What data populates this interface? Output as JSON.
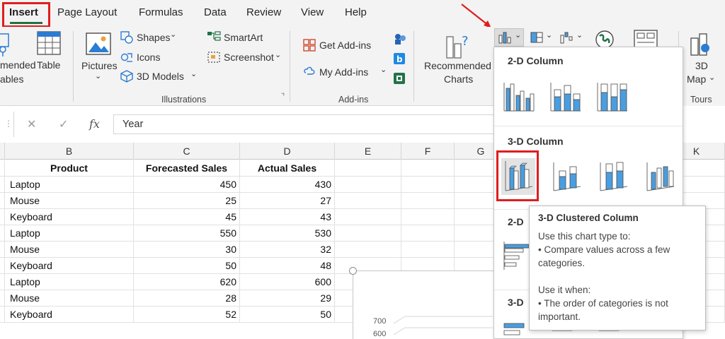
{
  "tabs": {
    "items": [
      "Insert",
      "Page Layout",
      "Formulas",
      "Data",
      "Review",
      "View",
      "Help"
    ]
  },
  "ribbon": {
    "tables": {
      "recommended_pivot_label_1": "mended",
      "recommended_pivot_label_2": "ables",
      "table_label": "Table"
    },
    "illustrations": {
      "pictures_label": "Pictures",
      "shapes_label": "Shapes",
      "icons_label": "Icons",
      "models_label": "3D Models",
      "smartart_label": "SmartArt",
      "screenshot_label": "Screenshot",
      "group_label": "Illustrations"
    },
    "addins": {
      "get_label": "Get Add-ins",
      "my_label": "My Add-ins",
      "group_label": "Add-ins"
    },
    "charts": {
      "recommended_line1": "Recommended",
      "recommended_line2": "Charts"
    },
    "tours": {
      "map_line1": "3D",
      "map_line2": "Map",
      "group_label": "Tours"
    }
  },
  "formula_bar": {
    "fx_label": "fx",
    "value": "Year"
  },
  "grid": {
    "column_headers": [
      "B",
      "C",
      "D",
      "E",
      "F",
      "G",
      "K"
    ],
    "table_headers": [
      "Product",
      "Forecasted Sales",
      "Actual Sales"
    ],
    "rows": [
      [
        "Laptop",
        "450",
        "430"
      ],
      [
        "Mouse",
        "25",
        "27"
      ],
      [
        "Keyboard",
        "45",
        "43"
      ],
      [
        "Laptop",
        "550",
        "530"
      ],
      [
        "Mouse",
        "30",
        "32"
      ],
      [
        "Keyboard",
        "50",
        "48"
      ],
      [
        "Laptop",
        "620",
        "600"
      ],
      [
        "Mouse",
        "28",
        "29"
      ],
      [
        "Keyboard",
        "52",
        "50"
      ]
    ]
  },
  "chart_preview": {
    "axis_labels": [
      "700",
      "600"
    ]
  },
  "gallery": {
    "section_2d_column": "2-D Column",
    "section_3d_column": "3-D Column",
    "section_2d_bar_partial": "2-D",
    "section_3d_bar_partial": "3-D"
  },
  "tooltip": {
    "title": "3-D Clustered Column",
    "line1": "Use this chart type to:",
    "line2": "• Compare values across a few",
    "line3": "categories.",
    "line4": "Use it when:",
    "line5": "• The order of categories is not",
    "line6": "important."
  },
  "colors": {
    "accent_red": "#e01d1d",
    "excel_green": "#1f7244",
    "chart_blue": "#4a9ee0"
  }
}
